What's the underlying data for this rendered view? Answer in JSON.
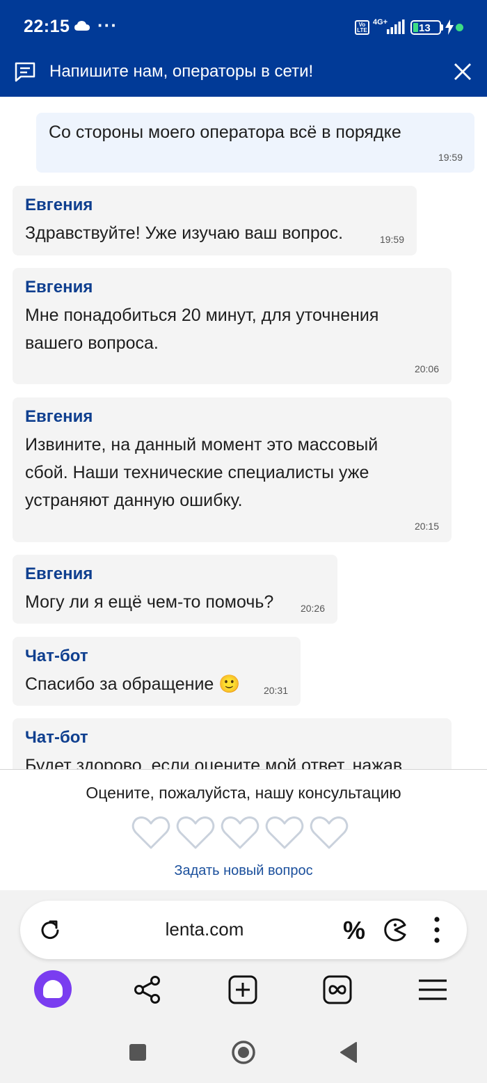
{
  "status_bar": {
    "time": "22:15",
    "volte": "Vo LTE",
    "network": "4G+",
    "battery": "13",
    "icons": [
      "cloud-icon",
      "more-dots-icon",
      "volte-icon",
      "signal-icon",
      "battery-icon",
      "charging-icon",
      "green-dot-icon"
    ]
  },
  "header": {
    "title": "Напишите нам, операторы в сети!",
    "icons": [
      "chat-icon",
      "close-icon"
    ],
    "color": "#013a97"
  },
  "messages": [
    {
      "sender": "",
      "text": "Со стороны моего оператора всё в порядке",
      "time": "19:59",
      "from": "user"
    },
    {
      "sender": "Евгения",
      "text": "Здравствуйте! Уже изучаю ваш вопрос.",
      "time": "19:59",
      "from": "operator"
    },
    {
      "sender": "Евгения",
      "text_lines": [
        "Мне понадобиться 20 минут, для уточнения",
        "вашего вопроса."
      ],
      "time": "20:06",
      "from": "operator"
    },
    {
      "sender": "Евгения",
      "text_lines": [
        "Извините, на данный момент это массовый",
        "сбой. Наши технические специалисты уже",
        "устраняют данную ошибку."
      ],
      "time": "20:15",
      "from": "operator"
    },
    {
      "sender": "Евгения",
      "text": "Могу ли я ещё чем-то помочь?",
      "time": "20:26",
      "from": "operator"
    },
    {
      "sender": "Чат-бот",
      "text": "Спасибо за обращение 🙂",
      "time": "20:31",
      "from": "bot"
    },
    {
      "sender": "Чат-бот",
      "text": "Будет здорово, если оцените мой ответ, нажав",
      "time": "",
      "from": "bot"
    }
  ],
  "rating": {
    "question": "Оцените, пожалуйста, нашу консультацию",
    "max": 5,
    "value": 0,
    "new_question": "Задать новый вопрос"
  },
  "browser": {
    "url": "lenta.com",
    "discount_icon": "%",
    "icons": [
      "reload-icon",
      "percent-icon",
      "pacman-icon",
      "kebab-menu-icon",
      "alice-icon",
      "share-icon",
      "new-tab-icon",
      "tabs-icon",
      "hamburger-menu-icon"
    ]
  },
  "nav": {
    "icons": [
      "recents-icon",
      "home-icon",
      "back-icon"
    ]
  }
}
